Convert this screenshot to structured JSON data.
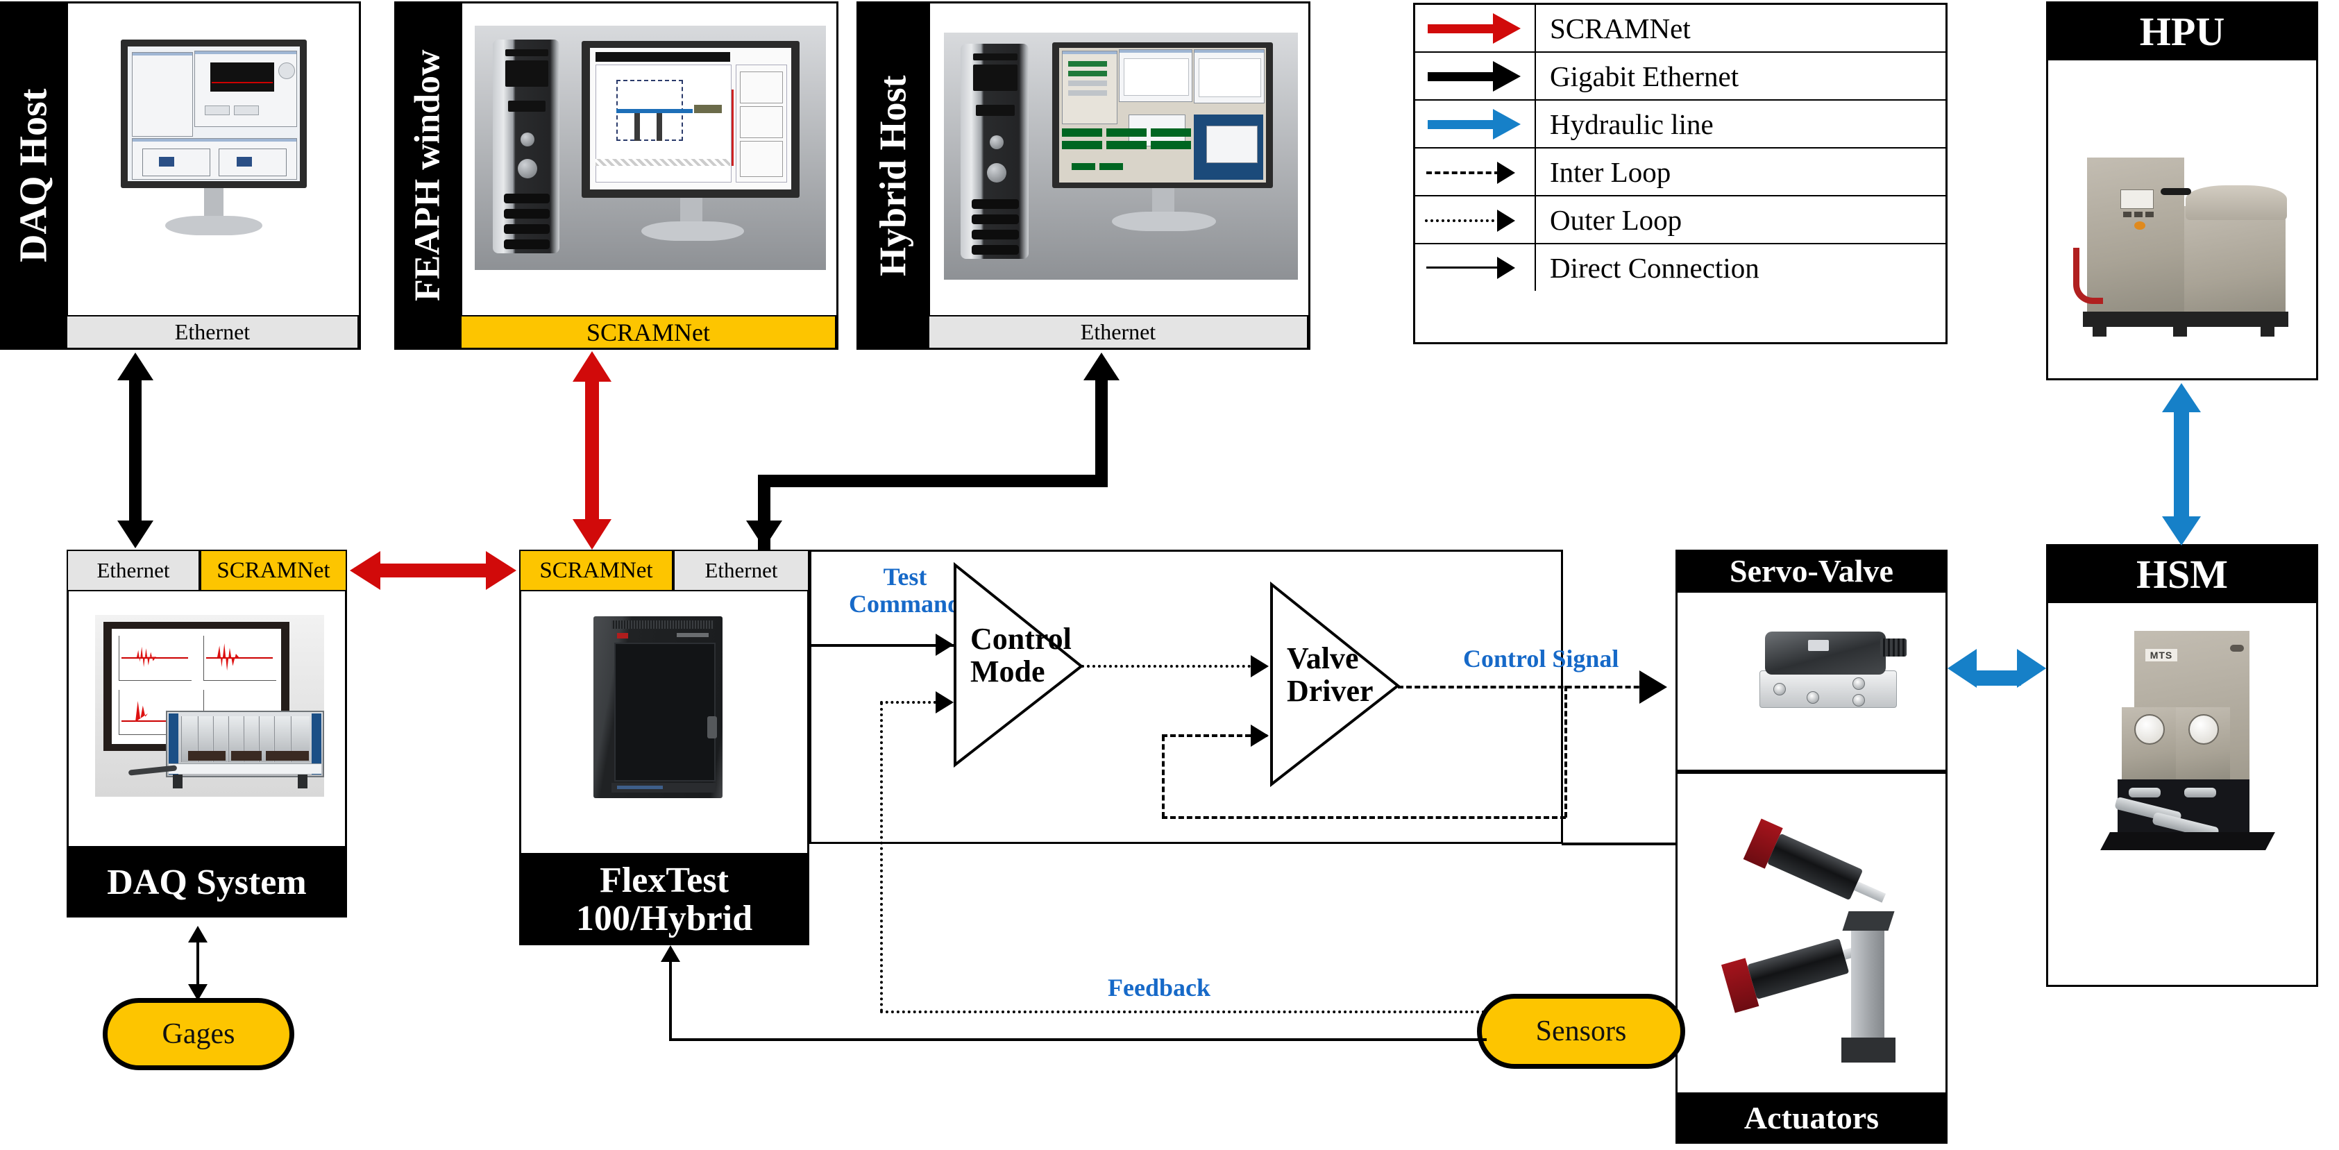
{
  "legend": {
    "rows": [
      {
        "label": "SCRAMNet",
        "style": "solid-thick",
        "color": "#d10a0a"
      },
      {
        "label": "Gigabit Ethernet",
        "style": "solid-thick",
        "color": "#000000"
      },
      {
        "label": "Hydraulic line",
        "style": "solid-thick",
        "color": "#1680c8"
      },
      {
        "label": "Inter Loop",
        "style": "dashed",
        "color": "#000000"
      },
      {
        "label": "Outer Loop",
        "style": "dotted",
        "color": "#000000"
      },
      {
        "label": "Direct Connection",
        "style": "solid-thin",
        "color": "#000000"
      }
    ]
  },
  "panels": {
    "daq_host": {
      "title": "DAQ Host",
      "net": "Ethernet",
      "net_type": "ethernet"
    },
    "feaph_window": {
      "title": "FEAPH window",
      "net": "SCRAMNet",
      "net_type": "scramnet"
    },
    "hybrid_host": {
      "title": "Hybrid Host",
      "net": "Ethernet",
      "net_type": "ethernet"
    },
    "daq_system": {
      "title": "DAQ System",
      "net_left": "Ethernet",
      "net_right": "SCRAMNet"
    },
    "flextest": {
      "title_line1": "FlexTest",
      "title_line2": "100/Hybrid",
      "net_left": "SCRAMNet",
      "net_right": "Ethernet"
    },
    "servo_valve": {
      "title": "Servo-Valve"
    },
    "actuators": {
      "title": "Actuators"
    },
    "hpu": {
      "title": "HPU"
    },
    "hsm": {
      "title": "HSM"
    }
  },
  "control_block": {
    "test_command_line1": "Test",
    "test_command_line2": "Command",
    "control_mode_line1": "Control",
    "control_mode_line2": "Mode",
    "valve_driver_line1": "Valve",
    "valve_driver_line2": "Driver",
    "control_signal": "Control Signal"
  },
  "nodes": {
    "gages": "Gages",
    "sensors": "Sensors",
    "feedback": "Feedback"
  },
  "colors": {
    "scramnet_red": "#d10a0a",
    "hydraulic_blue": "#1680c8",
    "label_blue": "#1669c8",
    "scramnet_band": "#fdc500",
    "ethernet_band": "#e4e4e4",
    "black": "#000000"
  }
}
